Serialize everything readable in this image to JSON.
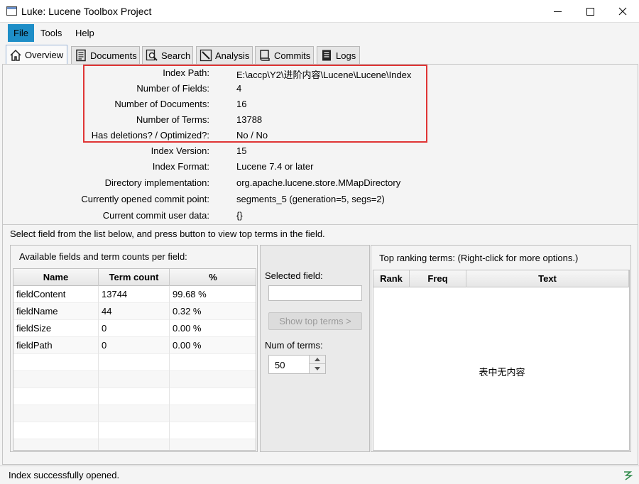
{
  "window": {
    "title": "Luke: Lucene Toolbox Project"
  },
  "menu": {
    "file": "File",
    "tools": "Tools",
    "help": "Help"
  },
  "tabs": {
    "overview": "Overview",
    "documents": "Documents",
    "search": "Search",
    "analysis": "Analysis",
    "commits": "Commits",
    "logs": "Logs"
  },
  "overview": {
    "index_path": {
      "label": "Index Path:",
      "value": "E:\\accp\\Y2\\进阶内容\\Lucene\\Lucene\\Index"
    },
    "num_fields": {
      "label": "Number of Fields:",
      "value": "4"
    },
    "num_docs": {
      "label": "Number of Documents:",
      "value": "16"
    },
    "num_terms": {
      "label": "Number of Terms:",
      "value": "13788"
    },
    "deletions": {
      "label": "Has deletions? / Optimized?:",
      "value": "No / No"
    },
    "version": {
      "label": "Index Version:",
      "value": "15"
    },
    "format": {
      "label": "Index Format:",
      "value": "Lucene 7.4 or later"
    },
    "directory": {
      "label": "Directory implementation:",
      "value": "org.apache.lucene.store.MMapDirectory"
    },
    "commit_point": {
      "label": "Currently opened commit point:",
      "value": "segments_5 (generation=5, segs=2)"
    },
    "commit_user_data": {
      "label": "Current commit user data:",
      "value": "{}"
    },
    "instruction": "Select field from the list below, and press button to view top terms in the field."
  },
  "fields_panel": {
    "title": "Available fields and term counts per field:",
    "headers": {
      "name": "Name",
      "count": "Term count",
      "pct": "%"
    },
    "rows": [
      {
        "name": "fieldContent",
        "count": "13744",
        "pct": "99.68 %"
      },
      {
        "name": "fieldName",
        "count": "44",
        "pct": "0.32 %"
      },
      {
        "name": "fieldSize",
        "count": "0",
        "pct": "0.00 %"
      },
      {
        "name": "fieldPath",
        "count": "0",
        "pct": "0.00 %"
      }
    ]
  },
  "selected_field": {
    "label": "Selected field:",
    "value": "",
    "show_button": "Show top terms >",
    "num_terms_label": "Num of terms:",
    "num_terms_value": "50"
  },
  "top_terms": {
    "title": "Top ranking terms: (Right-click for more options.)",
    "headers": {
      "rank": "Rank",
      "freq": "Freq",
      "text": "Text"
    },
    "empty_message": "表中无内容"
  },
  "status": {
    "message": "Index successfully opened."
  },
  "colors": {
    "menu_active": "#1e8ec7",
    "highlight_border": "#e03535"
  }
}
